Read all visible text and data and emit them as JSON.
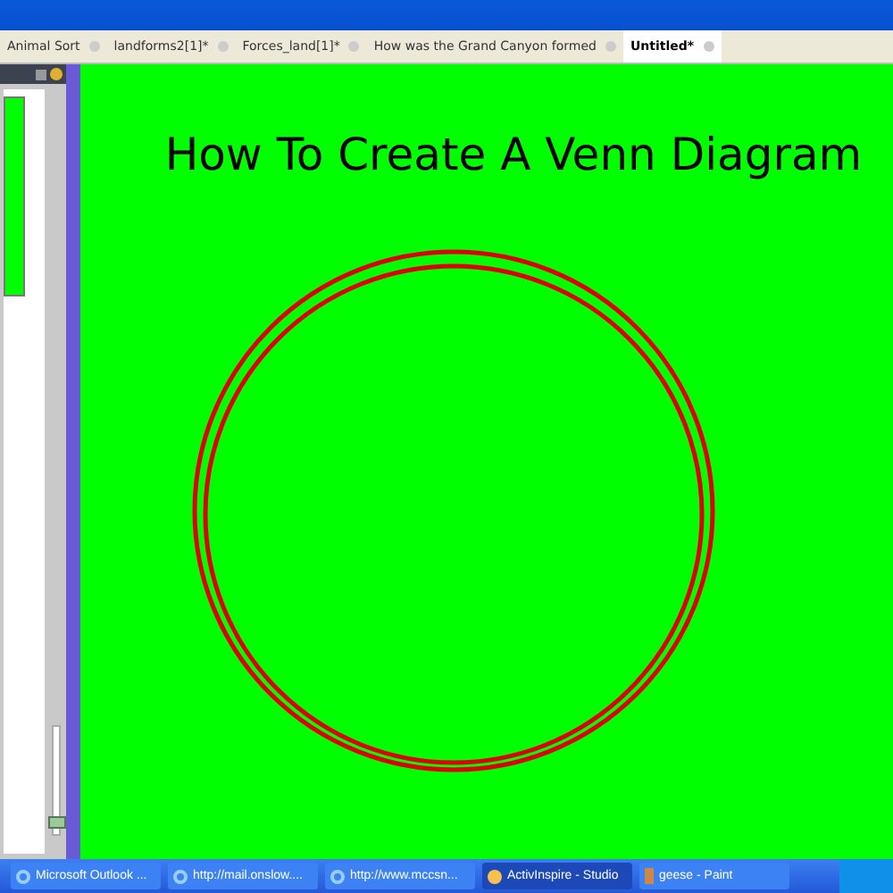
{
  "tabs": [
    {
      "label": "Animal Sort",
      "selected": false
    },
    {
      "label": "landforms2[1]*",
      "selected": false
    },
    {
      "label": "Forces_land[1]*",
      "selected": false
    },
    {
      "label": "How was the Grand Canyon formed",
      "selected": false
    },
    {
      "label": "Untitled*",
      "selected": true
    }
  ],
  "canvas": {
    "title": "How To Create A Venn Diagram"
  },
  "side_panel": {
    "zoom": {
      "level": 0.05
    }
  },
  "taskbar": [
    {
      "label": "Microsoft Outlook ...",
      "kind": "browser",
      "selected": false
    },
    {
      "label": "http://mail.onslow....",
      "kind": "browser",
      "selected": false
    },
    {
      "label": "http://www.mccsn...",
      "kind": "browser",
      "selected": false
    },
    {
      "label": "ActivInspire - Studio",
      "kind": "disc",
      "selected": true
    },
    {
      "label": "geese - Paint",
      "kind": "paint",
      "selected": false
    }
  ]
}
